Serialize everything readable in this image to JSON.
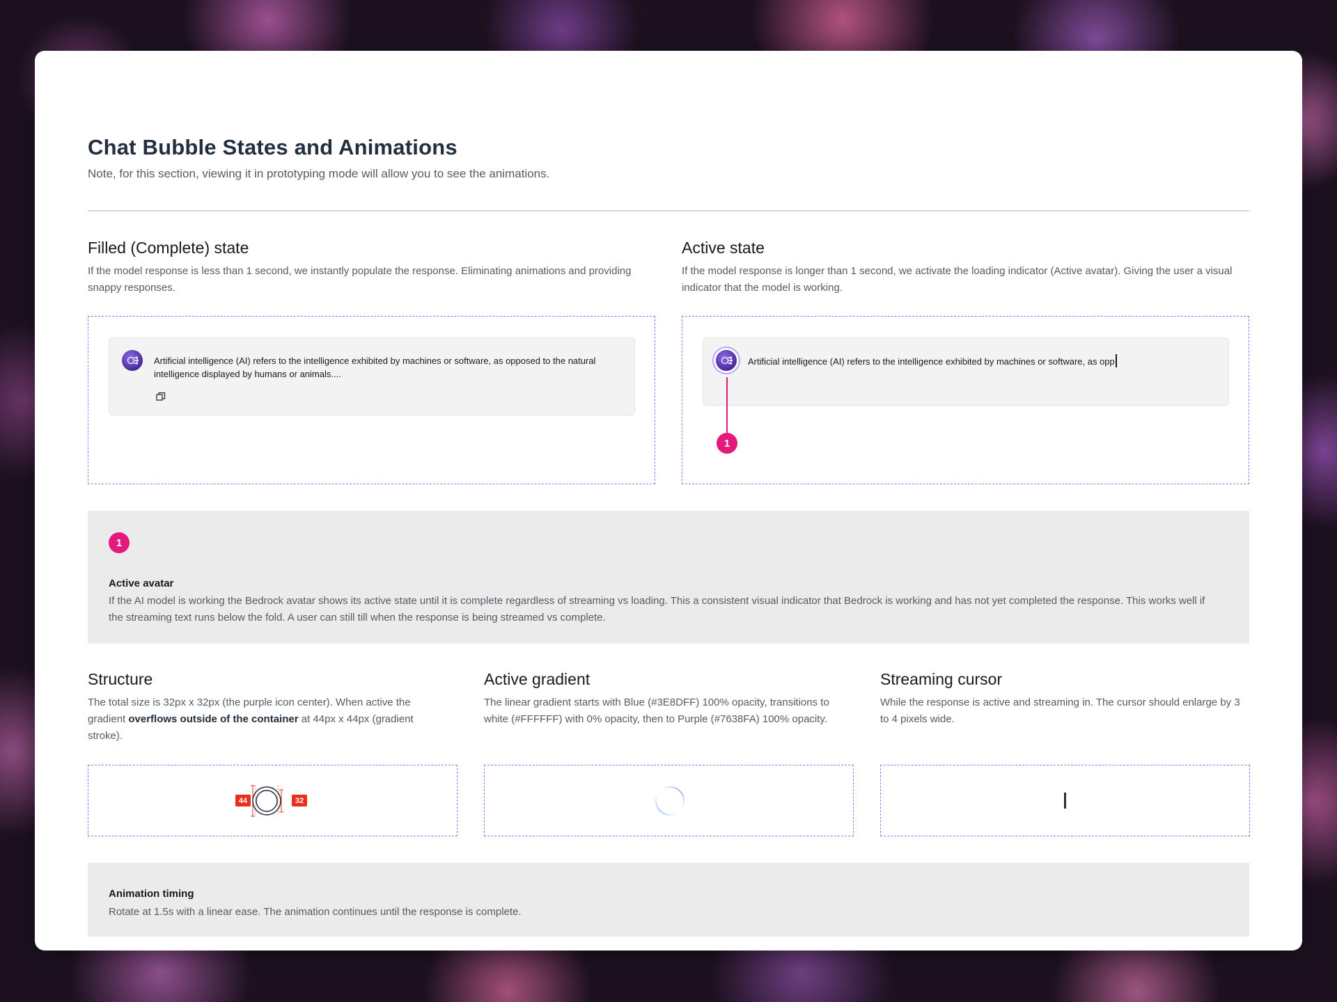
{
  "header": {
    "title": "Chat Bubble States and Animations",
    "subtitle": "Note, for this section, viewing it in prototyping mode will allow you to see the animations."
  },
  "filled_state": {
    "title": "Filled (Complete) state",
    "description": "If the model response is less than 1 second, we instantly populate the response. Eliminating animations and providing snappy responses.",
    "bubble_text": "Artificial intelligence (AI) refers to the intelligence exhibited by machines or software, as opposed to the natural intelligence displayed by humans or animals....",
    "copy_icon": "copy-icon",
    "avatar_icon": "brain-icon"
  },
  "active_state": {
    "title": "Active state",
    "description": "If the model response is longer than 1 second, we activate the loading indicator (Active avatar). Giving the user a visual indicator that the model is working.",
    "bubble_text": "Artificial intelligence (AI) refers to the intelligence exhibited by machines or software, as opp",
    "callout_number": "1",
    "avatar_icon": "brain-icon"
  },
  "active_avatar_note": {
    "badge": "1",
    "title": "Active avatar",
    "body": "If the AI model is working the Bedrock avatar shows its active state until it is complete regardless of streaming vs loading. This a consistent visual indicator that Bedrock is working and has not yet completed the response. This works well if the streaming text runs below the fold. A user can still till when the response is being streamed vs complete."
  },
  "structure": {
    "title": "Structure",
    "desc_before": "The total size is 32px x 32px (the purple icon center). When active the gradient ",
    "desc_bold": "overflows outside of the container",
    "desc_after": " at 44px x 44px (gradient stroke).",
    "outer_size_label": "44",
    "inner_size_label": "32"
  },
  "active_gradient": {
    "title": "Active gradient",
    "description": "The linear gradient starts with Blue (#3E8DFF) 100% opacity, transitions to white (#FFFFFF) with 0% opacity, then to Purple (#7638FA) 100% opacity.",
    "colors": {
      "blue": "#3E8DFF",
      "white": "#FFFFFF",
      "purple": "#7638FA"
    }
  },
  "streaming_cursor": {
    "title": "Streaming cursor",
    "description": "While the response is active and streaming in. The cursor should enlarge by 3 to 4 pixels wide."
  },
  "animation_timing": {
    "title": "Animation timing",
    "body": "Rotate at 1.5s with a linear ease. The animation continues until the response is complete."
  },
  "colors": {
    "accent_dash": "#8a7cf5",
    "callout_pink": "#e3197b",
    "size_tag_red": "#e8301b"
  }
}
